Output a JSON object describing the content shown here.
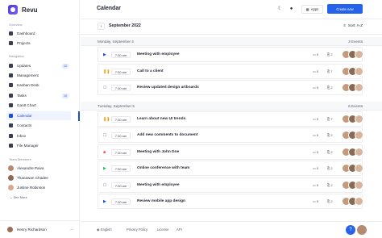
{
  "app": {
    "name": "Revu"
  },
  "sidebar": {
    "overview_label": "Overview",
    "overview_items": [
      {
        "label": "Dashboard"
      },
      {
        "label": "Projects"
      }
    ],
    "navigation_label": "Navigation",
    "navigation_items": [
      {
        "label": "Updates",
        "badge": "12"
      },
      {
        "label": "Management",
        "badge": ""
      },
      {
        "label": "Kanban Desk",
        "badge": ""
      },
      {
        "label": "Tasks",
        "badge": "10"
      },
      {
        "label": "Gantt Chart",
        "badge": ""
      },
      {
        "label": "Calendar",
        "badge": "",
        "active": true
      },
      {
        "label": "Contacts",
        "badge": ""
      },
      {
        "label": "Inbox",
        "badge": ""
      },
      {
        "label": "File Manager",
        "badge": ""
      }
    ],
    "team_label": "Team Members",
    "members": [
      {
        "name": "Alexandre Paiva"
      },
      {
        "name": "Thanawan Chadee"
      },
      {
        "name": "Justine Robinson"
      }
    ],
    "see_more": "See More",
    "user": {
      "name": "Henry Richardson",
      "more": "⋯"
    }
  },
  "header": {
    "title": "Calendar",
    "apps_label": "Apps",
    "create_label": "Create new"
  },
  "toolbar": {
    "prev": "‹",
    "next": "›",
    "month": "September 2022",
    "sort_label": "Sort: A-Z"
  },
  "days": [
    {
      "date": "Monday, September 4",
      "count": "3 Events",
      "events": [
        {
          "status": "play",
          "color": "#1d4ed8",
          "time": "7:30 am",
          "title": "Meeting with employee",
          "comments": "5",
          "attachments": "2"
        },
        {
          "status": "pause",
          "color": "#f59e0b",
          "time": "7:30 am",
          "title": "Call to a client",
          "comments": "5",
          "attachments": "7"
        },
        {
          "status": "check",
          "color": "#6b7280",
          "time": "7:30 am",
          "title": "Review updated design artboards",
          "comments": "5",
          "attachments": "2"
        }
      ]
    },
    {
      "date": "Tuesday, September 5",
      "count": "6 Events",
      "events": [
        {
          "status": "pause",
          "color": "#f59e0b",
          "time": "7:30 am",
          "title": "Learn about new UI trends",
          "comments": "5",
          "attachments": "7"
        },
        {
          "status": "check",
          "color": "#6b7280",
          "time": "7:30 am",
          "title": "Add new comments to document",
          "comments": "5",
          "attachments": "2"
        },
        {
          "status": "stop",
          "color": "#ef4444",
          "time": "7:30 am",
          "title": "Meeting with John Doe",
          "comments": "5",
          "attachments": "2"
        },
        {
          "status": "play",
          "color": "#22c55e",
          "time": "7:30 am",
          "title": "Online conference with team",
          "comments": "5",
          "attachments": "2"
        },
        {
          "status": "check",
          "color": "#6b7280",
          "time": "7:30 am",
          "title": "Meeting with employee",
          "comments": "5",
          "attachments": "2"
        },
        {
          "status": "play",
          "color": "#1d4ed8",
          "time": "7:30 am",
          "title": "Review mobile app design",
          "comments": "5",
          "attachments": "2"
        }
      ]
    }
  ],
  "footer": {
    "language": "English",
    "privacy": "Privacy Policy",
    "license": "License",
    "api": "API"
  },
  "colors": {
    "accent": "#2563eb",
    "active_bg": "#eef3ff"
  }
}
